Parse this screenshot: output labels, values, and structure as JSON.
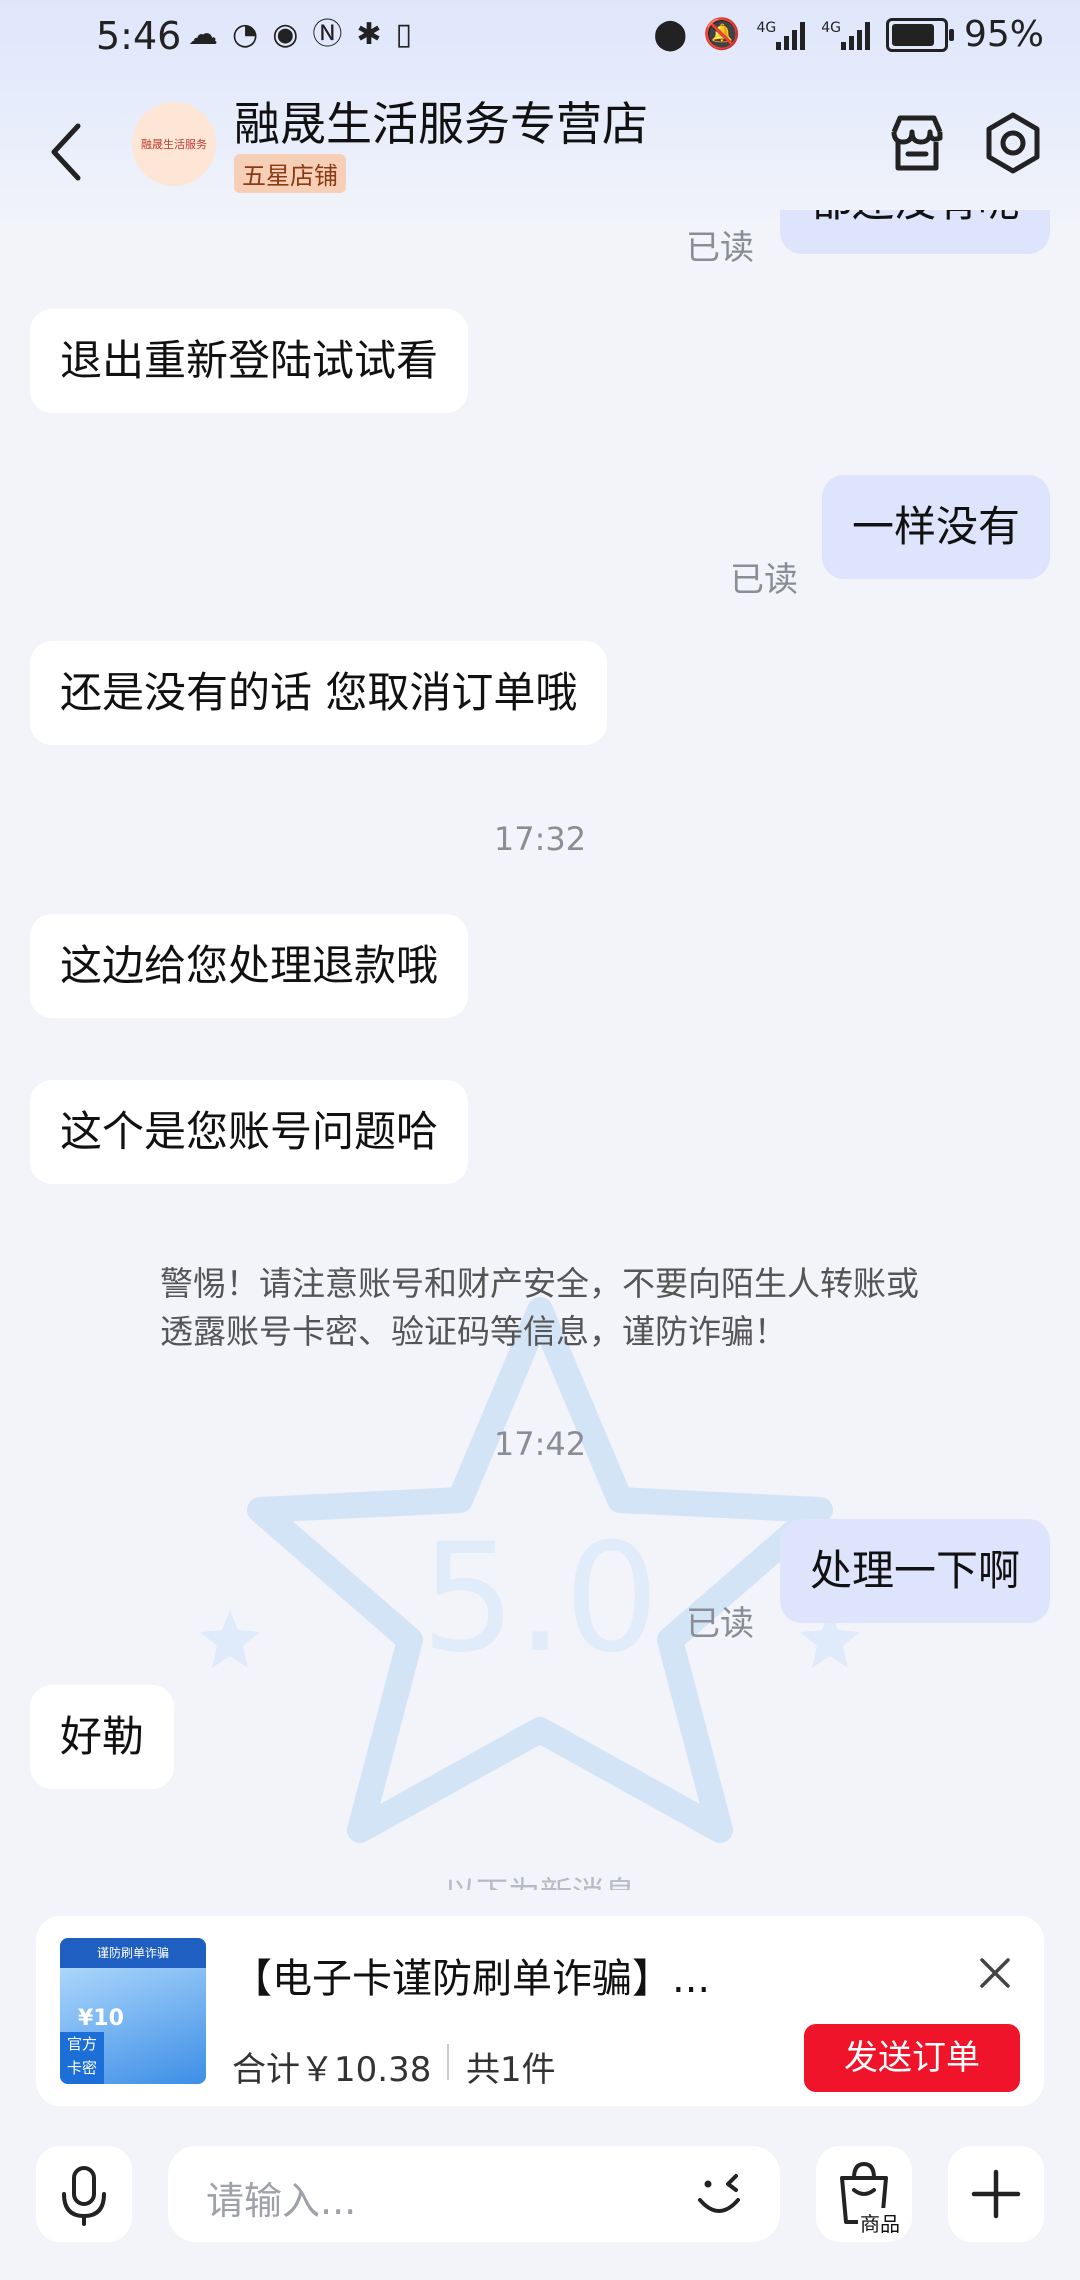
{
  "status_bar": {
    "time": "5:46",
    "battery": "95%",
    "battery_level": 0.95,
    "network_1": "4G",
    "network_2": "4G"
  },
  "header": {
    "shop_name": "融晟生活服务专营店",
    "avatar_text": "融晟生活服务",
    "badge": "五星店铺",
    "icons": [
      "back-icon",
      "store-icon",
      "settings-icon"
    ]
  },
  "chat": {
    "messages": [
      {
        "side": "out",
        "text": "都还没有呢",
        "read": "已读"
      },
      {
        "side": "in",
        "text": "退出重新登陆试试看"
      },
      {
        "side": "out",
        "text": "一样没有",
        "read": "已读"
      },
      {
        "side": "in",
        "text": "还是没有的话 您取消订单哦"
      },
      {
        "type": "time",
        "text": "17:32"
      },
      {
        "side": "in",
        "text": "这边给您处理退款哦"
      },
      {
        "side": "in",
        "text": "这个是您账号问题哈"
      },
      {
        "type": "notice",
        "text": "警惕！请注意账号和财产安全，不要向陌生人转账或透露账号卡密、验证码等信息，谨防诈骗！"
      },
      {
        "type": "time",
        "text": "17:42"
      },
      {
        "side": "out",
        "text": "处理一下啊",
        "read": "已读"
      },
      {
        "side": "in",
        "text": "好勒"
      }
    ],
    "new_messages_divider": "以下为新消息"
  },
  "order_card": {
    "title": "【电子卡谨防刷单诈骗】...",
    "total": "合计￥10.38",
    "count": "共1件",
    "send_button": "发送订单",
    "thumb_tag": "官方卡密",
    "thumb_value": "¥10",
    "thumb_banner": "谨防刷单诈骗"
  },
  "input_bar": {
    "placeholder": "请输入...",
    "product_button": "商品"
  },
  "colors": {
    "accent_red": "#f0142b",
    "out_bubble": "#dde4fb",
    "in_bubble": "#ffffff",
    "background": "#f3f4fa"
  }
}
